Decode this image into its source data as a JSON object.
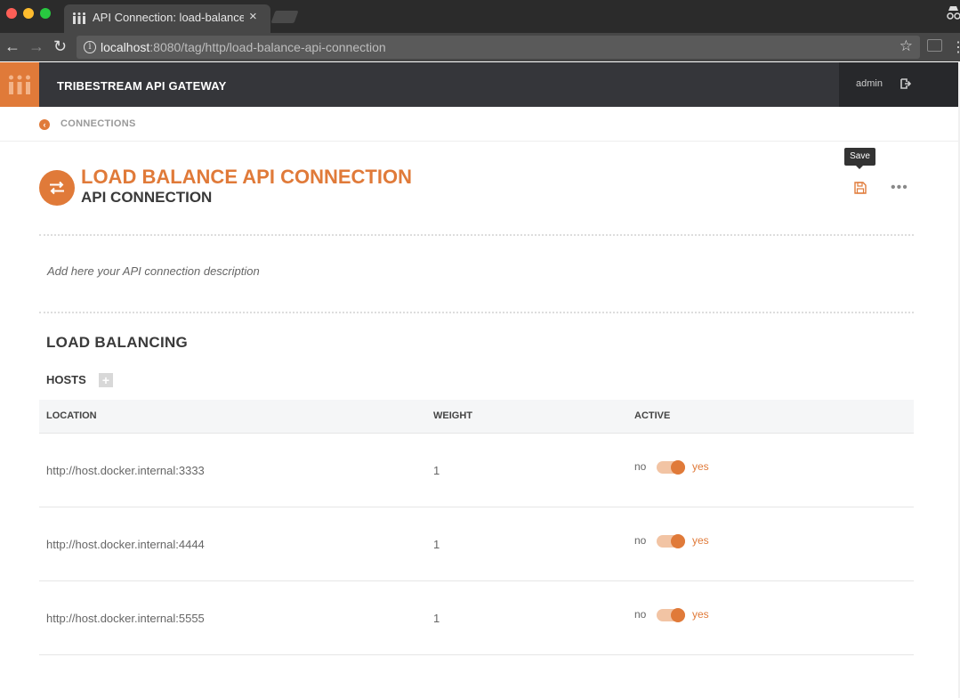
{
  "browser": {
    "tab_title": "API Connection: load-balance-api-connection",
    "close_glyph": "×",
    "url_host": "localhost",
    "url_path": ":8080/tag/http/load-balance-api-connection"
  },
  "app": {
    "brand": "TRIBESTREAM API GATEWAY",
    "user": "admin",
    "accent_color": "#e07a39",
    "header_color": "#35363a"
  },
  "breadcrumb": {
    "label": "CONNECTIONS"
  },
  "page": {
    "title": "LOAD BALANCE API CONNECTION",
    "subtitle": "API CONNECTION",
    "save_tooltip": "Save",
    "description": "Add here your API connection description"
  },
  "load_balancing": {
    "title": "LOAD BALANCING",
    "hosts_label": "HOSTS",
    "columns": {
      "location": "LOCATION",
      "weight": "WEIGHT",
      "active": "ACTIVE"
    },
    "toggle_off_label": "no",
    "toggle_on_label": "yes",
    "hosts": [
      {
        "location": "http://host.docker.internal:3333",
        "weight": "1",
        "active": true
      },
      {
        "location": "http://host.docker.internal:4444",
        "weight": "1",
        "active": true
      },
      {
        "location": "http://host.docker.internal:5555",
        "weight": "1",
        "active": true
      }
    ]
  }
}
